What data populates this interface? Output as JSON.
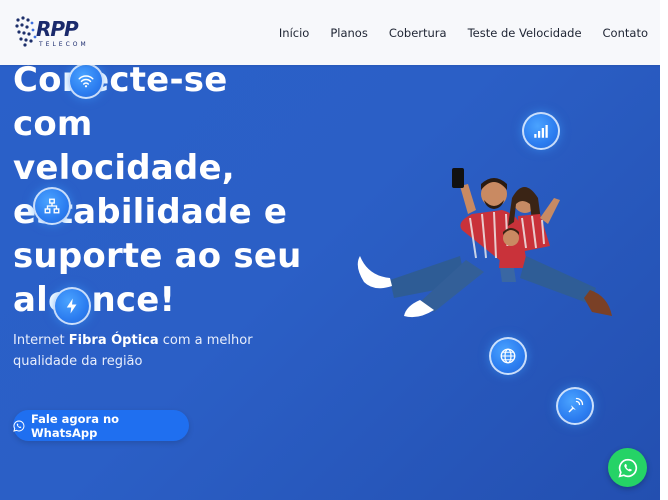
{
  "brand": {
    "name": "RPP",
    "sub": "TELECOM"
  },
  "nav": {
    "items": [
      {
        "label": "Início"
      },
      {
        "label": "Planos"
      },
      {
        "label": "Cobertura"
      },
      {
        "label": "Teste de Velocidade"
      },
      {
        "label": "Contato"
      }
    ]
  },
  "hero": {
    "title": "Conecte-se com velocidade, estabilidade e suporte ao seu alcance!",
    "subtitle_pre": "Internet ",
    "subtitle_bold": "Fibra Óptica",
    "subtitle_post": " com a melhor qualidade da região",
    "cta_label": "Fale agora no WhatsApp"
  },
  "icons": {
    "bubbles": [
      "wifi-icon",
      "network-icon",
      "lightning-icon",
      "signal-icon",
      "globe-icon",
      "satellite-icon"
    ],
    "floating": "whatsapp-icon"
  },
  "colors": {
    "hero_bg": "#2a5fc7",
    "cta_bg": "#1f6ff0",
    "whatsapp": "#25d366",
    "header_bg": "#f7f8fb"
  }
}
